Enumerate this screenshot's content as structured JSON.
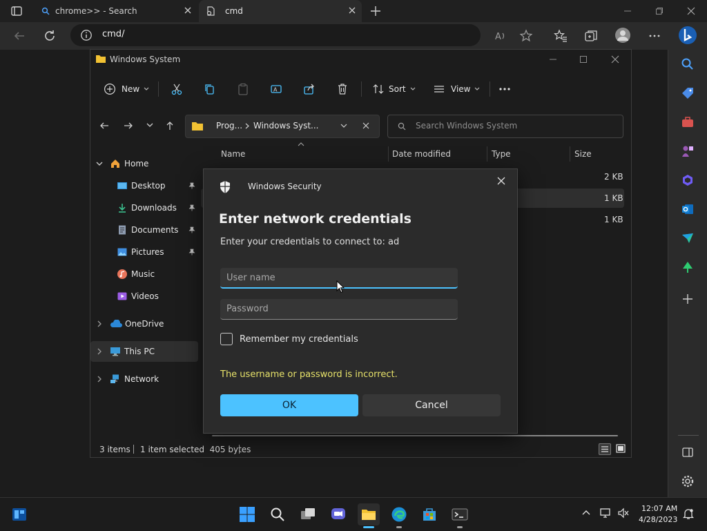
{
  "browser": {
    "tabs": [
      {
        "title": "chrome>> - Search"
      },
      {
        "title": "cmd"
      }
    ],
    "address": "cmd/"
  },
  "explorer": {
    "title": "Windows System",
    "commands": {
      "new": "New",
      "sort": "Sort",
      "view": "View"
    },
    "breadcrumb": [
      "Prog...",
      "Windows Syst..."
    ],
    "search_placeholder": "Search Windows System",
    "nav": {
      "home": "Home",
      "desktop": "Desktop",
      "downloads": "Downloads",
      "documents": "Documents",
      "pictures": "Pictures",
      "music": "Music",
      "videos": "Videos",
      "onedrive": "OneDrive",
      "thispc": "This PC",
      "network": "Network"
    },
    "columns": {
      "name": "Name",
      "date": "Date modified",
      "type": "Type",
      "size": "Size"
    },
    "rows": [
      {
        "type": "ut",
        "size": "2 KB"
      },
      {
        "type": "ut",
        "size": "1 KB"
      },
      {
        "type": "ut",
        "size": "1 KB"
      }
    ],
    "status": {
      "items": "3 items",
      "selected": "1 item selected  405 bytes"
    }
  },
  "dialog": {
    "app": "Windows Security",
    "heading": "Enter network credentials",
    "subtitle": "Enter your credentials to connect to: ad",
    "username_placeholder": "User name",
    "password_placeholder": "Password",
    "remember": "Remember my credentials",
    "error": "The username or password is incorrect.",
    "ok": "OK",
    "cancel": "Cancel"
  },
  "taskbar": {
    "time": "12:07 AM",
    "date": "4/28/2023"
  },
  "colors": {
    "accent": "#4cc2ff",
    "error": "#e8e36a",
    "folder": "#f2c233"
  }
}
